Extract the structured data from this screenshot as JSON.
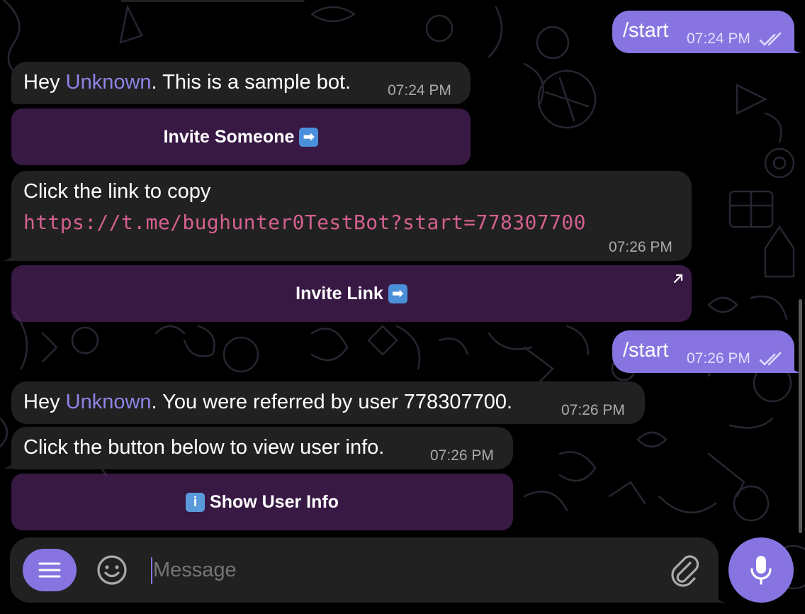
{
  "messages": {
    "out1": {
      "text": "/start",
      "time": "07:24 PM"
    },
    "in1": {
      "prefix": "Hey ",
      "mention": "Unknown",
      "suffix": ". This is a sample bot.",
      "time": "07:24 PM"
    },
    "btn_invite_someone": {
      "label": "Invite Someone",
      "icon": "right-arrow-emoji"
    },
    "in2": {
      "line1": "Click the link to copy",
      "link": "https://t.me/bughunter0TestBot?start=778307700",
      "time": "07:26 PM"
    },
    "btn_invite_link": {
      "label": "Invite Link",
      "icon": "right-arrow-emoji",
      "corner_icon": "external-link-arrow-icon"
    },
    "out2": {
      "text": "/start",
      "time": "07:26 PM"
    },
    "in3": {
      "prefix": "Hey ",
      "mention": "Unknown",
      "suffix": ". You were referred by user 778307700.",
      "time": "07:26 PM"
    },
    "in4": {
      "text": "Click the button below to view user info.",
      "time": "07:26 PM"
    },
    "btn_show_user_info": {
      "label": "Show User Info",
      "icon": "info-emoji"
    }
  },
  "composer": {
    "placeholder": "Message",
    "menu_icon": "menu-icon",
    "emoji_icon": "emoji-icon",
    "attach_icon": "paperclip-icon",
    "mic_icon": "microphone-icon"
  },
  "colors": {
    "background": "#000000",
    "incoming_bubble": "#212121",
    "outgoing_bubble": "#8774e1",
    "mention": "#8f84e8",
    "link": "#d4608f",
    "keyboard_button": "#3d1f4b",
    "accent": "#8774e1"
  }
}
